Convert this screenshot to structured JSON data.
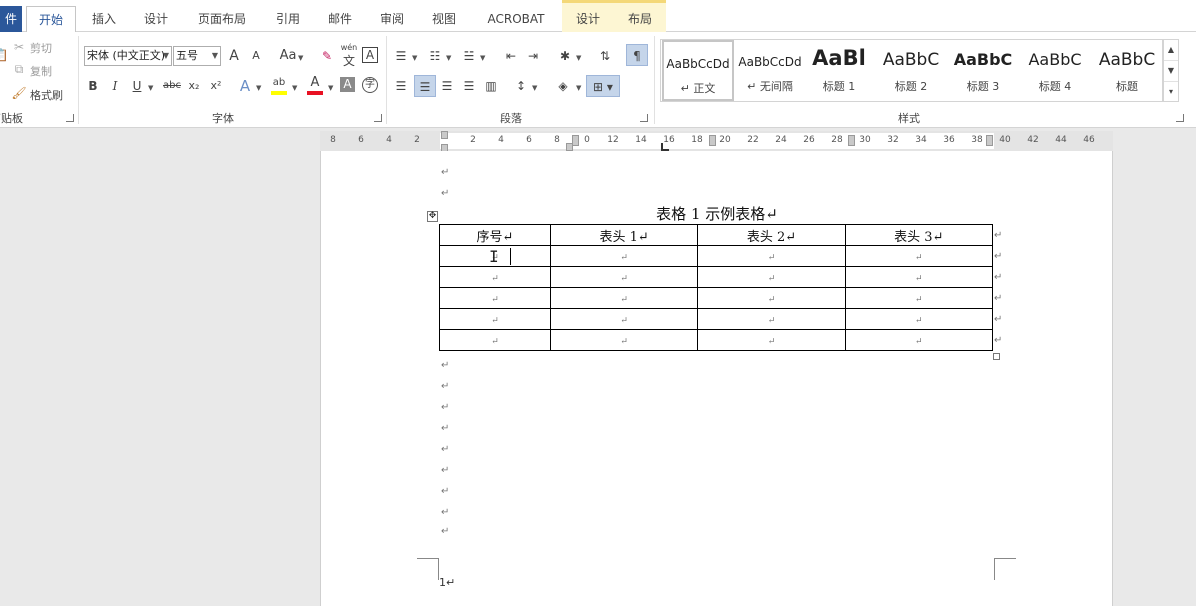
{
  "tabs": {
    "file": "件",
    "home": "开始",
    "insert": "插入",
    "design": "设计",
    "page_layout": "页面布局",
    "references": "引用",
    "mailings": "邮件",
    "review": "审阅",
    "view": "视图",
    "acrobat": "ACROBAT",
    "table_design": "设计",
    "table_layout": "布局"
  },
  "clipboard": {
    "cut": "剪切",
    "copy": "复制",
    "format_painter": "格式刷",
    "label": "剪贴板"
  },
  "font": {
    "name": "宋体 (中文正文)",
    "size": "五号",
    "grow": "A",
    "shrink": "A",
    "case": "Aa",
    "phonetic_top": "wén",
    "phonetic_bottom": "文",
    "border_char": "A",
    "bold": "B",
    "italic": "I",
    "underline": "U",
    "strike": "abc",
    "subscript": "x₂",
    "superscript": "x²",
    "effects": "A",
    "highlight": "ab",
    "color": "A",
    "shade_char": "A",
    "circle_char": "字",
    "label": "字体"
  },
  "paragraph": {
    "label": "段落"
  },
  "styles": {
    "label": "样式",
    "items": [
      {
        "preview": "AaBbCcDd",
        "name": "↵ 正文"
      },
      {
        "preview": "AaBbCcDd",
        "name": "↵ 无间隔"
      },
      {
        "preview": "AaBl",
        "name": "标题 1"
      },
      {
        "preview": "AaBbC",
        "name": "标题 2"
      },
      {
        "preview": "AaBbC",
        "name": "标题 3"
      },
      {
        "preview": "AaBbC",
        "name": "标题 4"
      },
      {
        "preview": "AaBbC",
        "name": "标题"
      }
    ]
  },
  "ruler": {
    "ticks": [
      "8",
      "6",
      "4",
      "2",
      "2",
      "4",
      "6",
      "8",
      "0",
      "12",
      "14",
      "16",
      "18",
      "20",
      "22",
      "24",
      "26",
      "28",
      "30",
      "32",
      "34",
      "36",
      "38",
      "40",
      "42",
      "44",
      "46"
    ]
  },
  "document": {
    "caption": "表格 1 示例表格↵",
    "paragraph_mark": "↵",
    "page_number": "1↵",
    "table": {
      "headers": [
        "序号↵",
        "表头 1↵",
        "表头 2↵",
        "表头 3↵"
      ],
      "rows": [
        [
          "↵",
          "↵",
          "↵",
          "↵"
        ],
        [
          "↵",
          "↵",
          "↵",
          "↵"
        ],
        [
          "↵",
          "↵",
          "↵",
          "↵"
        ],
        [
          "↵",
          "↵",
          "↵",
          "↵"
        ],
        [
          "↵",
          "↵",
          "↵",
          "↵"
        ]
      ]
    }
  },
  "colors": {
    "accent": "#2b579a",
    "highlight": "#ffff00",
    "font_color": "#e81123",
    "context_tab": "#fdf6d3"
  }
}
